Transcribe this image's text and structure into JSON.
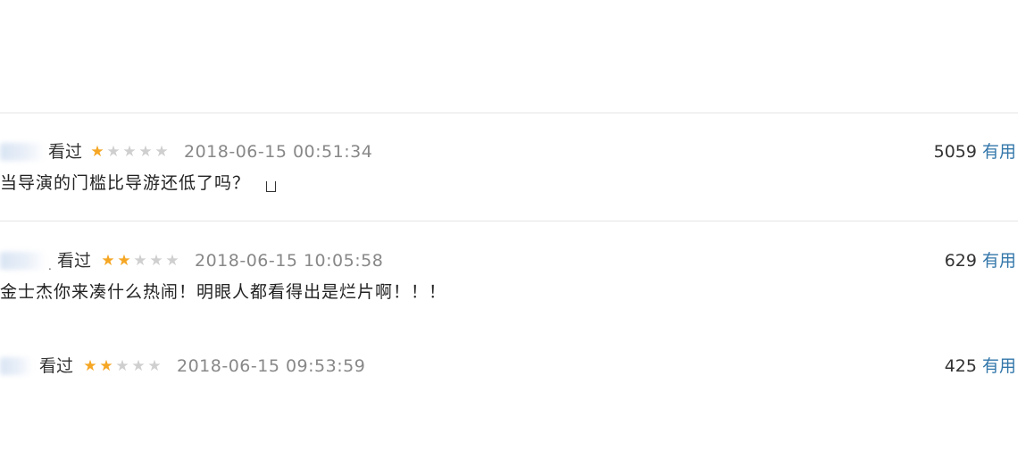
{
  "comments": [
    {
      "status": "看过",
      "rating": 1,
      "time": "2018-06-15 00:51:34",
      "votes": "5059",
      "useful_label": "有用",
      "text": "当导演的门槛比导游还低了吗？"
    },
    {
      "status": "看过",
      "rating": 2,
      "time": "2018-06-15 10:05:58",
      "votes": "629",
      "useful_label": "有用",
      "text": "金士杰你来凑什么热闹！明眼人都看得出是烂片啊！！！"
    },
    {
      "status": "看过",
      "rating": 2,
      "time": "2018-06-15 09:53:59",
      "votes": "425",
      "useful_label": "有用",
      "text": ""
    }
  ],
  "star_max": 5,
  "colors": {
    "star_on": "#f5a623",
    "star_off": "#cfcfcf",
    "link": "#37a"
  }
}
